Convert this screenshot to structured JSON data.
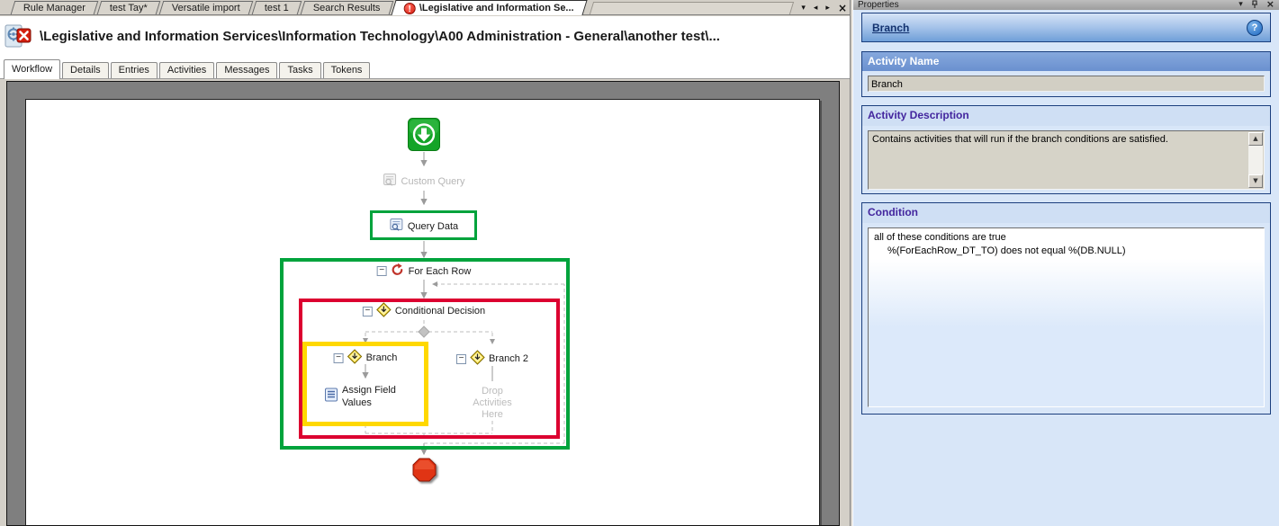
{
  "doc_tabs": {
    "items": [
      {
        "label": "Rule Manager"
      },
      {
        "label": "test Tay*"
      },
      {
        "label": "Versatile import"
      },
      {
        "label": "test 1"
      },
      {
        "label": "Search Results"
      }
    ],
    "active": {
      "label": "\\Legislative and Information Se..."
    },
    "controls": {
      "dropdown": "▾",
      "prev": "◂",
      "next": "▸",
      "close": "×"
    }
  },
  "document": {
    "title": "\\Legislative and Information Services\\Information Technology\\A00 Administration - General\\another test\\..."
  },
  "view_tabs": {
    "items": [
      "Workflow",
      "Details",
      "Entries",
      "Activities",
      "Messages",
      "Tasks",
      "Tokens"
    ],
    "active": "Workflow"
  },
  "icons": {
    "collapse": "−",
    "alert": "!",
    "scroll_up": "▲",
    "scroll_down": "▼",
    "panel_dropdown": "▾",
    "panel_close": "×"
  },
  "workflow": {
    "nodes": {
      "custom_query": "Custom Query",
      "query_data": "Query Data",
      "for_each_row": "For Each Row",
      "conditional_decision": "Conditional Decision",
      "branch": "Branch",
      "branch2": "Branch 2",
      "assign_field_values": "Assign Field Values",
      "drop_hint": "Drop Activities Here"
    }
  },
  "properties": {
    "panel_title": "Properties",
    "header": {
      "title": "Branch",
      "help": "?"
    },
    "activity_name": {
      "label": "Activity Name",
      "value": "Branch"
    },
    "activity_description": {
      "label": "Activity Description",
      "value": "Contains activities that will run if the branch conditions are satisfied."
    },
    "condition": {
      "label": "Condition",
      "line1": "all of these conditions are true",
      "line2": "%(ForEachRow_DT_TO) does not equal %(DB.NULL)"
    }
  },
  "colors": {
    "highlight_green": "#00a33c",
    "highlight_red": "#dc0030",
    "highlight_yellow": "#ffd800",
    "panel_background": "#d8e6f8",
    "banner_blue": "#6f9fd8",
    "section_header_blue": "#6a90cf",
    "section_title_purple": "#43269e",
    "start_green": "#12a425",
    "stop_red": "#d42410"
  }
}
